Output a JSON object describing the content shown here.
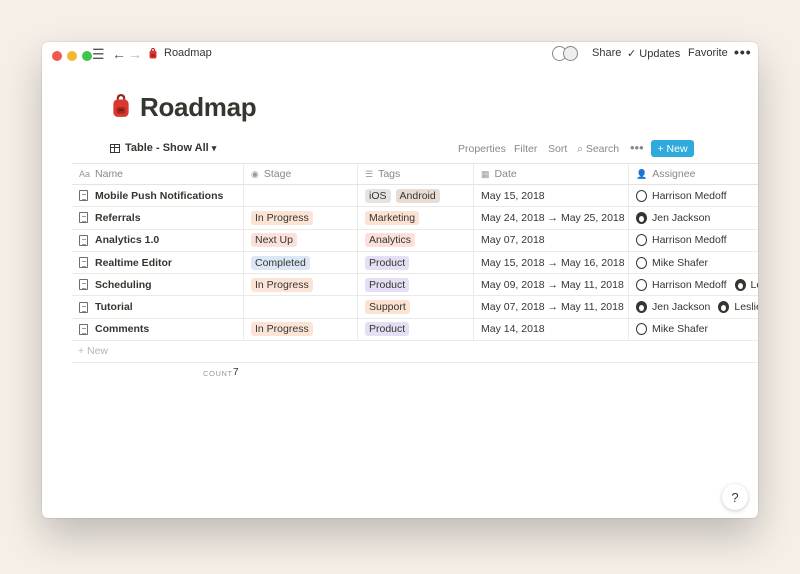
{
  "titlebar": {
    "breadcrumb": "Roadmap",
    "share": "Share",
    "updates": "Updates",
    "favorite": "Favorite",
    "more": "•••"
  },
  "page": {
    "title": "Roadmap",
    "emoji": "backpack-icon"
  },
  "viewbar": {
    "view_label": "Table - Show All",
    "properties": "Properties",
    "filter": "Filter",
    "sort": "Sort",
    "search": "Search",
    "more": "•••",
    "new": "New"
  },
  "columns": [
    "Name",
    "Stage",
    "Tags",
    "Date",
    "Assignee"
  ],
  "rows": [
    {
      "name": "Mobile Push Notifications",
      "stage": "",
      "tags": [
        "iOS",
        "Android"
      ],
      "date": "May 15, 2018",
      "assignees": [
        "Harrison Medoff"
      ]
    },
    {
      "name": "Referrals",
      "stage": "In Progress",
      "tags": [
        "Marketing"
      ],
      "date": "May 24, 2018 → May 25, 2018",
      "assignees": [
        "Jen Jackson"
      ]
    },
    {
      "name": "Analytics 1.0",
      "stage": "Next Up",
      "tags": [
        "Analytics"
      ],
      "date": "May 07, 2018",
      "assignees": [
        "Harrison Medoff"
      ]
    },
    {
      "name": "Realtime Editor",
      "stage": "Completed",
      "tags": [
        "Product"
      ],
      "date": "May 15, 2018 → May 16, 2018",
      "assignees": [
        "Mike Shafer"
      ]
    },
    {
      "name": "Scheduling",
      "stage": "In Progress",
      "tags": [
        "Product"
      ],
      "date": "May 09, 2018 → May 11, 2018",
      "assignees": [
        "Harrison Medoff",
        "Les"
      ]
    },
    {
      "name": "Tutorial",
      "stage": "",
      "tags": [
        "Support"
      ],
      "date": "May 07, 2018 → May 11, 2018",
      "assignees": [
        "Jen Jackson",
        "Leslie"
      ]
    },
    {
      "name": "Comments",
      "stage": "In Progress",
      "tags": [
        "Product"
      ],
      "date": "May 14, 2018",
      "assignees": [
        "Mike Shafer"
      ]
    }
  ],
  "add_row": "+ New",
  "footer": {
    "count_label": "COUNT",
    "count_value": "7"
  },
  "help": "?",
  "colors": {
    "accent": "#2eaadc",
    "stage_in_progress": "#fbe4d6",
    "stage_next_up": "#fbe0dc",
    "stage_completed": "#dbe7f5",
    "tag_ios": "#e5e4e2",
    "tag_android": "#e8ddd5",
    "tag_marketing": "#fbe2d3",
    "tag_analytics": "#fbe0dc",
    "tag_product": "#e4dff5",
    "tag_support": "#fbe2d3"
  }
}
